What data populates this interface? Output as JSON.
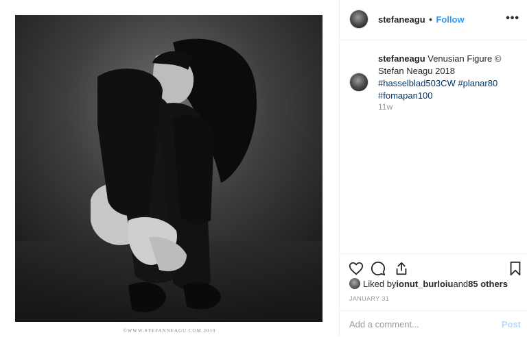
{
  "post": {
    "username": "stefaneagu",
    "separator": "•",
    "follow_label": "Follow",
    "more_label": "•••",
    "caption_user": "stefaneagu",
    "caption_text": " Venusian Figure © Stefan Neagu 2018 ",
    "hashtags": [
      "#hasselblad503CW",
      "#planar80",
      "#fomapan100"
    ],
    "age": "11w",
    "liked_by_prefix": "Liked by ",
    "liked_by_user": "ionut_burloiu",
    "liked_by_and": " and ",
    "liked_by_others": "85 others",
    "date": "JANUARY 31",
    "comment_placeholder": "Add a comment...",
    "post_label": "Post"
  },
  "photo": {
    "watermark": "©WWW.STEFANNEAGU.COM 2019"
  },
  "icons": [
    "heart-icon",
    "comment-icon",
    "share-icon",
    "bookmark-icon",
    "more-icon"
  ],
  "colors": {
    "link": "#3897f0",
    "hashtag": "#003569",
    "muted": "#999999",
    "post_disabled": "#b3dbff"
  }
}
